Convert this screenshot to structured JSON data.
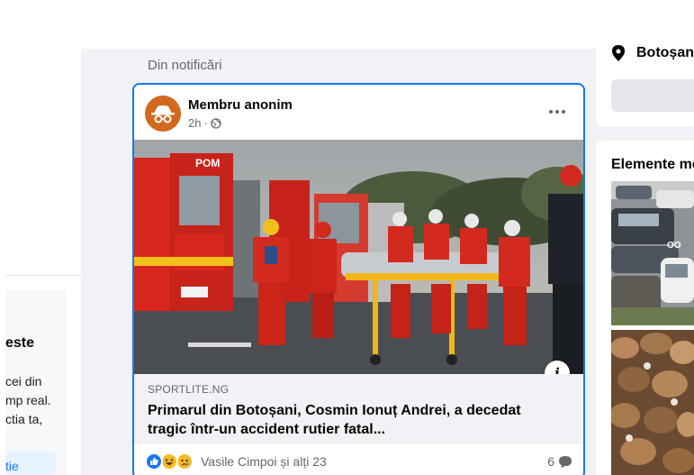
{
  "left_panel": {
    "heading": "este",
    "text_lines": [
      "cei din",
      "mp real.",
      "ctia ta,"
    ],
    "link_label": "tie"
  },
  "feed": {
    "section_label": "Din notificări",
    "post": {
      "author": "Membru anonim",
      "time": "2h",
      "meta_separator": "·",
      "privacy_icon": "globe-icon",
      "more_icon": "more-horizontal-icon",
      "image_alt": "Rescue team carrying a stretcher next to ambulances labelled POM",
      "link": {
        "source": "SPORTLITE.NG",
        "title": "Primarul din Botoșani, Cosmin Ionuț Andrei, a decedat tragic într-un accident rutier fatal..."
      },
      "reactions": {
        "icons": [
          "like-icon",
          "haha-icon",
          "sad-icon"
        ],
        "names": "Vasile Cimpoi și alți 23",
        "comment_count": "6"
      }
    }
  },
  "right_panel": {
    "location": "Botoșan",
    "marketplace_title": "Elemente me"
  },
  "colors": {
    "accent": "#1877f2",
    "feed_background": "#f0f2f5",
    "avatar": "#d2691e",
    "secondary_text": "#65676b"
  }
}
